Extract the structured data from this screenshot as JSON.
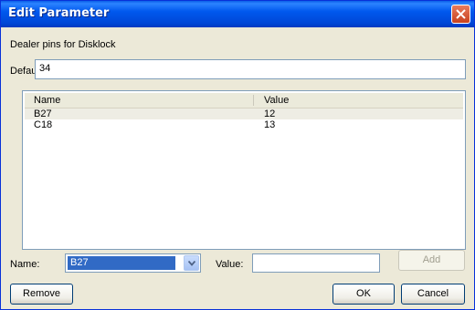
{
  "window": {
    "title": "Edit Parameter"
  },
  "description": "Dealer pins for Disklock",
  "default": {
    "label": "Default:",
    "value": "34"
  },
  "list": {
    "columns": [
      "Name",
      "Value"
    ],
    "rows": [
      {
        "name": "B27",
        "value": "12",
        "selected": true
      },
      {
        "name": "C18",
        "value": "13",
        "selected": false
      }
    ]
  },
  "form": {
    "name_label": "Name:",
    "name_selected": "B27",
    "value_label": "Value:",
    "value_text": "",
    "add_label": "Add"
  },
  "buttons": {
    "remove": "Remove",
    "ok": "OK",
    "cancel": "Cancel"
  },
  "colors": {
    "titlebar": "#0054e3",
    "selection": "#316ac5",
    "close": "#e04a2a"
  },
  "icons": {
    "close": "close-icon",
    "dropdown": "chevron-down-icon"
  }
}
